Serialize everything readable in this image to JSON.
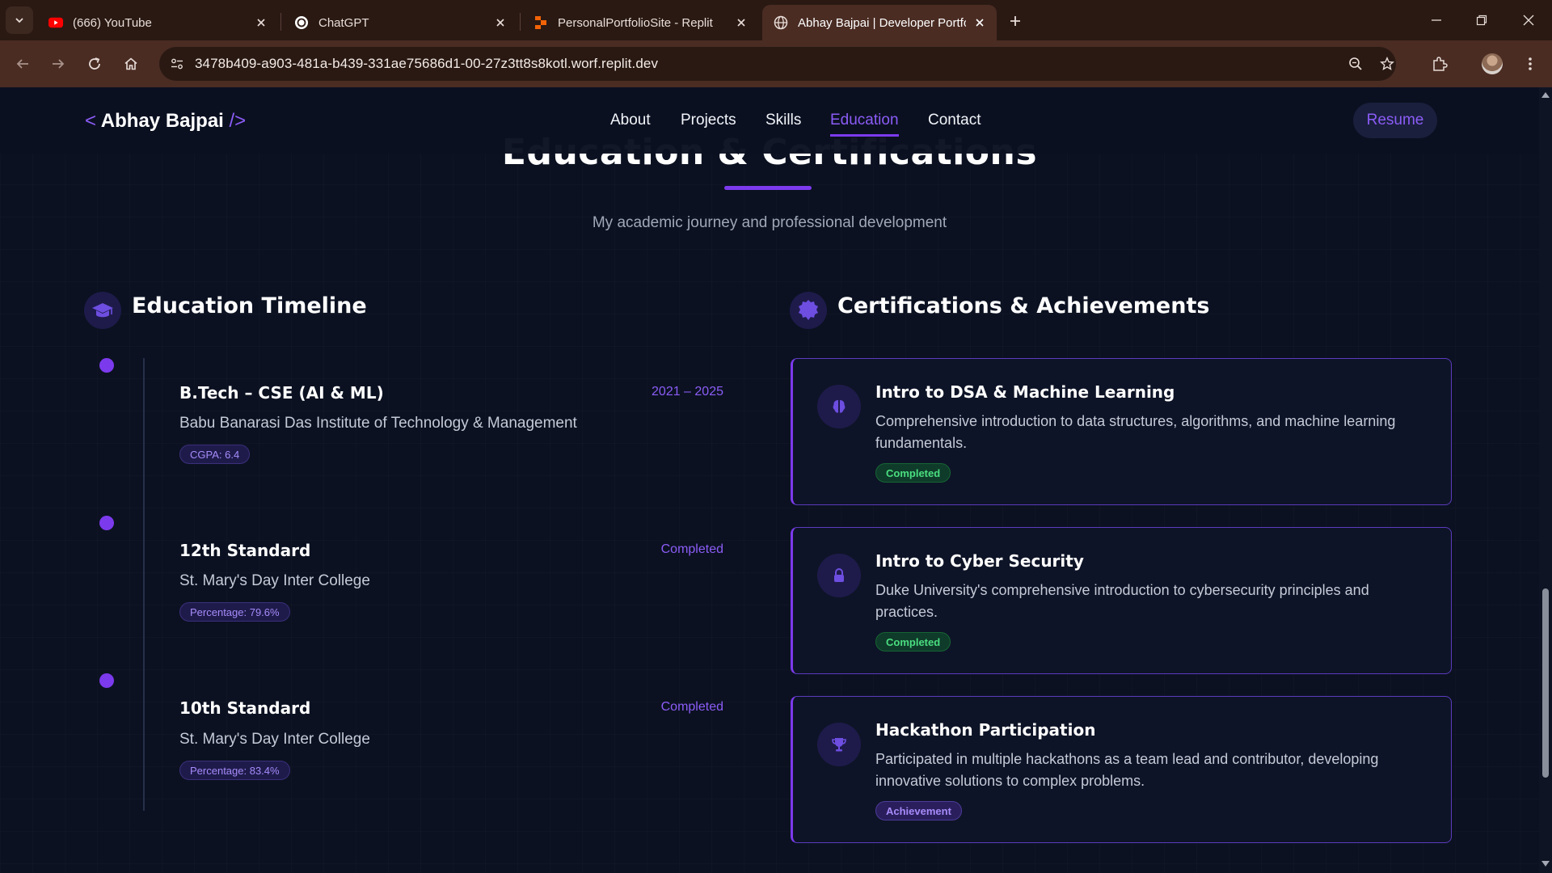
{
  "browser": {
    "tabs": [
      {
        "title": "(666) YouTube",
        "icon": "youtube-icon"
      },
      {
        "title": "ChatGPT",
        "icon": "chatgpt-icon"
      },
      {
        "title": "PersonalPortfolioSite - Replit",
        "icon": "replit-icon"
      },
      {
        "title": "Abhay Bajpai | Developer Portfolio",
        "icon": "globe-icon",
        "active": true
      }
    ],
    "url": "3478b409-a903-481a-b439-331ae75686d1-00-27z3tt8s8kotl.worf.replit.dev"
  },
  "nav": {
    "logo_open": "<",
    "logo_name": "Abhay Bajpai",
    "logo_close": "/>",
    "links": [
      "About",
      "Projects",
      "Skills",
      "Education",
      "Contact"
    ],
    "active_link": "Education",
    "resume_label": "Resume"
  },
  "section": {
    "heading": "Education & Certifications",
    "subtitle": "My academic journey and professional development"
  },
  "education": {
    "title": "Education Timeline",
    "items": [
      {
        "title": "B.Tech – CSE (AI & ML)",
        "meta": "2021 – 2025",
        "institution": "Babu Banarasi Das Institute of Technology & Management",
        "badge": "CGPA: 6.4"
      },
      {
        "title": "12th Standard",
        "meta": "Completed",
        "institution": "St. Mary's Day Inter College",
        "badge": "Percentage: 79.6%"
      },
      {
        "title": "10th Standard",
        "meta": "Completed",
        "institution": "St. Mary's Day Inter College",
        "badge": "Percentage: 83.4%"
      }
    ]
  },
  "certifications": {
    "title": "Certifications & Achievements",
    "items": [
      {
        "title": "Intro to DSA & Machine Learning",
        "description": "Comprehensive introduction to data structures, algorithms, and machine learning fundamentals.",
        "badge": "Completed",
        "icon": "brain-icon"
      },
      {
        "title": "Intro to Cyber Security",
        "description": "Duke University's comprehensive introduction to cybersecurity principles and practices.",
        "badge": "Completed",
        "icon": "lock-icon"
      },
      {
        "title": "Hackathon Participation",
        "description": "Participated in multiple hackathons as a team lead and contributor, developing innovative solutions to complex problems.",
        "badge": "Achievement",
        "icon": "trophy-icon"
      }
    ]
  },
  "colors": {
    "accent": "#7c3aed",
    "background": "#0b1121",
    "success": "#4ade80"
  }
}
